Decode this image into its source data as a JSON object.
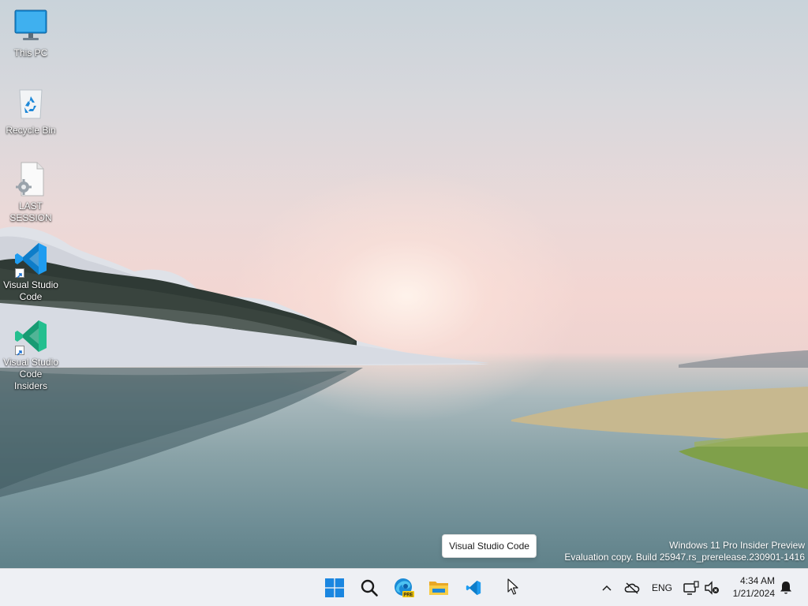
{
  "desktop": {
    "icons": [
      {
        "name": "this-pc",
        "label": "This PC"
      },
      {
        "name": "recycle-bin",
        "label": "Recycle Bin"
      },
      {
        "name": "last-session",
        "label": "LAST SESSION"
      },
      {
        "name": "vscode",
        "label": "Visual Studio Code"
      },
      {
        "name": "vscode-insiders",
        "label": "Visual Studio Code Insiders"
      }
    ],
    "watermark": {
      "line1": "Windows 11 Pro Insider Preview",
      "line2": "Evaluation copy. Build 25947.rs_prerelease.230901-1416"
    }
  },
  "tooltip": {
    "text": "Visual Studio Code"
  },
  "taskbar": {
    "pinned": [
      {
        "name": "start-button",
        "icon": "windows-logo-icon"
      },
      {
        "name": "search-button",
        "icon": "search-icon"
      },
      {
        "name": "edge-preview-button",
        "icon": "edge-pre-icon",
        "badge": "PRE"
      },
      {
        "name": "file-explorer-button",
        "icon": "folder-icon"
      },
      {
        "name": "vscode-button",
        "icon": "vscode-icon"
      }
    ],
    "tray": {
      "language": "ENG",
      "time": "4:34 AM",
      "date": "1/21/2024"
    }
  },
  "colors": {
    "taskbar_bg": "#eef0f4",
    "windows_blue": "#0078d4",
    "vscode_blue": "#23a9f2",
    "vscode_insiders_green": "#24bf8f"
  }
}
